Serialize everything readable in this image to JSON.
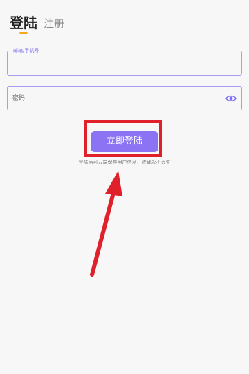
{
  "tabs": {
    "login_label": "登陆",
    "register_label": "注册"
  },
  "form": {
    "email_label": "邮箱/手机号",
    "email_value": "",
    "password_placeholder": "密码",
    "login_button_label": "立即登陆",
    "hint": "登陆后可云端保存用户信息，收藏永不丢失"
  },
  "colors": {
    "accent": "#8b73f3",
    "tab_underline": "#f5a623",
    "annotation_red": "#e0202a"
  },
  "icons": {
    "password_toggle": "eye-icon"
  }
}
